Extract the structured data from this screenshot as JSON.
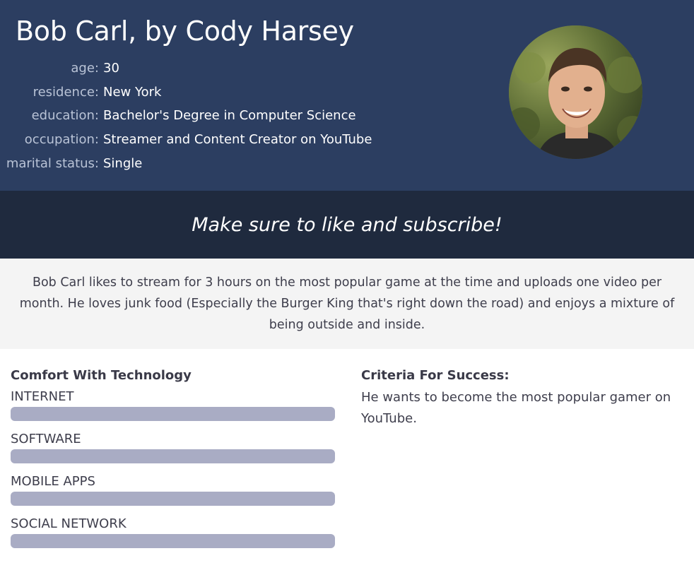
{
  "header": {
    "title": "Bob Carl, by Cody Harsey",
    "facts": [
      {
        "label": "age:",
        "value": "30"
      },
      {
        "label": "residence:",
        "value": "New York"
      },
      {
        "label": "education:",
        "value": "Bachelor's Degree in Computer Science"
      },
      {
        "label": "occupation:",
        "value": "Streamer and Content Creator on YouTube"
      },
      {
        "label": "marital status:",
        "value": "Single"
      }
    ]
  },
  "quote": "Make sure to like and subscribe!",
  "bio": "Bob Carl likes to stream for 3 hours on the most popular game at the time and uploads one video per month. He loves junk food (Especially the Burger King that's right down the road) and enjoys a mixture of being outside and inside.",
  "technology": {
    "heading": "Comfort With Technology",
    "meters": [
      {
        "label": "INTERNET",
        "level": 1.0
      },
      {
        "label": "SOFTWARE",
        "level": 1.0
      },
      {
        "label": "MOBILE APPS",
        "level": 1.0
      },
      {
        "label": "SOCIAL NETWORK",
        "level": 1.0
      }
    ]
  },
  "criteria": {
    "heading": "Criteria For Success:",
    "text": "He wants to become the most popular gamer on YouTube."
  },
  "colors": {
    "header_bg": "#2c3e61",
    "quote_bg": "#1f2a3e",
    "bio_bg": "#f4f4f4",
    "meter": "#a9acc4"
  }
}
